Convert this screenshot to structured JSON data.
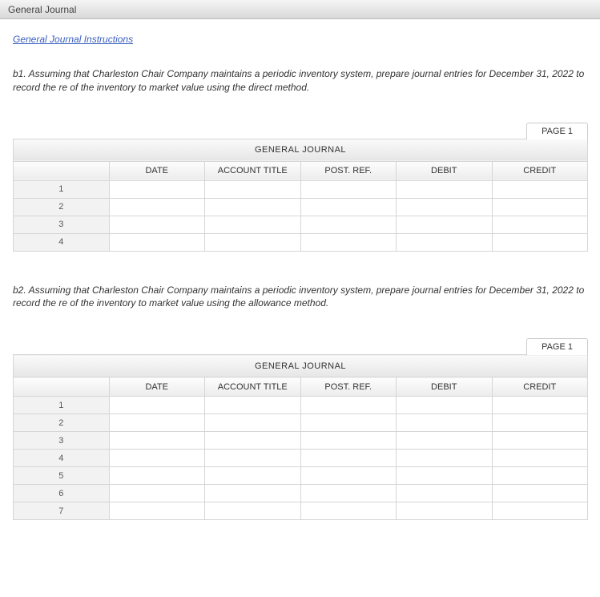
{
  "tab": {
    "title": "General Journal"
  },
  "link": {
    "label": "General Journal Instructions"
  },
  "block1": {
    "prompt": "b1. Assuming that Charleston Chair Company maintains a periodic inventory system, prepare journal entries for December 31, 2022 to record the re of the inventory to market value using the direct method.",
    "page_label": "PAGE 1",
    "table_title": "GENERAL JOURNAL",
    "headers": {
      "date": "DATE",
      "account": "ACCOUNT TITLE",
      "postref": "POST. REF.",
      "debit": "DEBIT",
      "credit": "CREDIT"
    },
    "rows": [
      {
        "n": "1",
        "date": "",
        "account": "",
        "postref": "",
        "debit": "",
        "credit": ""
      },
      {
        "n": "2",
        "date": "",
        "account": "",
        "postref": "",
        "debit": "",
        "credit": ""
      },
      {
        "n": "3",
        "date": "",
        "account": "",
        "postref": "",
        "debit": "",
        "credit": ""
      },
      {
        "n": "4",
        "date": "",
        "account": "",
        "postref": "",
        "debit": "",
        "credit": ""
      }
    ]
  },
  "block2": {
    "prompt": "b2. Assuming that Charleston Chair Company maintains a periodic inventory system, prepare journal entries for December 31, 2022 to record the re of the inventory to market value using the allowance method.",
    "page_label": "PAGE 1",
    "table_title": "GENERAL JOURNAL",
    "headers": {
      "date": "DATE",
      "account": "ACCOUNT TITLE",
      "postref": "POST. REF.",
      "debit": "DEBIT",
      "credit": "CREDIT"
    },
    "rows": [
      {
        "n": "1",
        "date": "",
        "account": "",
        "postref": "",
        "debit": "",
        "credit": ""
      },
      {
        "n": "2",
        "date": "",
        "account": "",
        "postref": "",
        "debit": "",
        "credit": ""
      },
      {
        "n": "3",
        "date": "",
        "account": "",
        "postref": "",
        "debit": "",
        "credit": ""
      },
      {
        "n": "4",
        "date": "",
        "account": "",
        "postref": "",
        "debit": "",
        "credit": ""
      },
      {
        "n": "5",
        "date": "",
        "account": "",
        "postref": "",
        "debit": "",
        "credit": ""
      },
      {
        "n": "6",
        "date": "",
        "account": "",
        "postref": "",
        "debit": "",
        "credit": ""
      },
      {
        "n": "7",
        "date": "",
        "account": "",
        "postref": "",
        "debit": "",
        "credit": ""
      }
    ]
  }
}
